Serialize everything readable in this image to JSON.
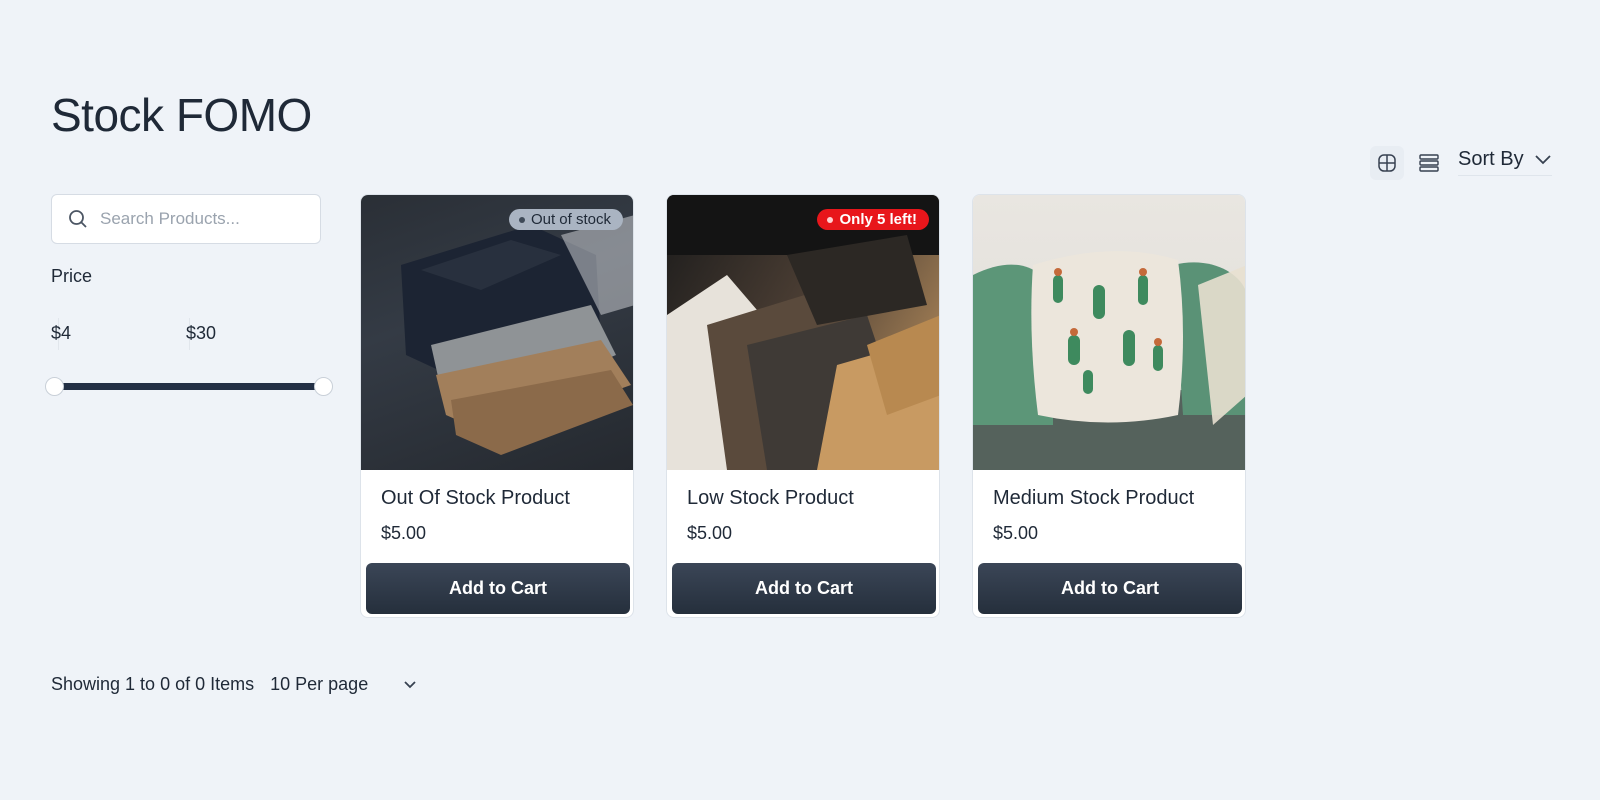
{
  "page": {
    "title": "Stock FOMO"
  },
  "toolbar": {
    "grid_view_icon": "grid-icon",
    "list_view_icon": "list-icon",
    "sort_label": "Sort By"
  },
  "search": {
    "placeholder": "Search Products..."
  },
  "price_filter": {
    "label": "Price",
    "min_label": "$4",
    "max_label": "$30",
    "min": 4,
    "max": 30
  },
  "products": [
    {
      "name": "Out Of Stock Product",
      "price": "$5.00",
      "badge": "Out of stock",
      "button": "Add to Cart"
    },
    {
      "name": "Low Stock Product",
      "price": "$5.00",
      "badge": "Only 5 left!",
      "button": "Add to Cart"
    },
    {
      "name": "Medium Stock Product",
      "price": "$5.00",
      "badge": "",
      "button": "Add to Cart"
    }
  ],
  "pagination": {
    "summary": "Showing 1 to 0 of 0 Items",
    "per_page": "10 Per page"
  },
  "colors": {
    "background": "#eff3f8",
    "button": "#2b3544",
    "badge_red": "#e8161b",
    "badge_grey": "#aab4c2"
  }
}
